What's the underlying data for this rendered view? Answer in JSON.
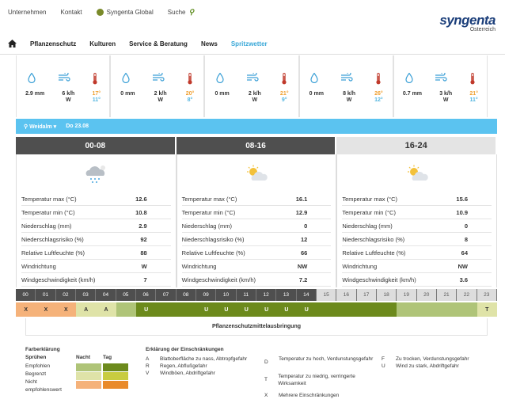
{
  "topnav": {
    "unternehmen": "Unternehmen",
    "kontakt": "Kontakt",
    "global": "Syngenta Global",
    "suche": "Suche"
  },
  "logo": {
    "brand": "syngenta",
    "country": "Österreich"
  },
  "mainnav": {
    "items": [
      "Pflanzenschutz",
      "Kulturen",
      "Service & Beratung",
      "News",
      "Spritzwetter"
    ],
    "active": "Spritzwetter"
  },
  "days": [
    {
      "stars": "",
      "precip": "2.9 mm",
      "wind": "6 k/h",
      "dir": "W",
      "tmax": "17°",
      "tmin": "11°"
    },
    {
      "stars": "",
      "precip": "0 mm",
      "wind": "2 k/h",
      "dir": "W",
      "tmax": "20°",
      "tmin": "8°"
    },
    {
      "stars": "",
      "precip": "0 mm",
      "wind": "2 k/h",
      "dir": "W",
      "tmax": "21°",
      "tmin": "9°"
    },
    {
      "stars": "",
      "precip": "0 mm",
      "wind": "8 k/h",
      "dir": "W",
      "tmax": "26°",
      "tmin": "12°"
    },
    {
      "stars": "",
      "precip": "0.7 mm",
      "wind": "3 k/h",
      "dir": "W",
      "tmax": "21°",
      "tmin": "11°"
    }
  ],
  "location": {
    "place": "Weidalm",
    "date": "Do 23.08"
  },
  "periods": [
    "00-08",
    "08-16",
    "16-24"
  ],
  "panels": [
    {
      "rows": [
        [
          "Temperatur max (°C)",
          "12.6"
        ],
        [
          "Temperatur min (°C)",
          "10.8"
        ],
        [
          "Niederschlag (mm)",
          "2.9"
        ],
        [
          "Niederschlagsrisiko (%)",
          "92"
        ],
        [
          "Relative Luftfeuchte (%)",
          "88"
        ],
        [
          "Windrichtung",
          "W"
        ],
        [
          "Windgeschwindigkeit (km/h)",
          "7"
        ]
      ]
    },
    {
      "rows": [
        [
          "Temperatur max (°C)",
          "16.1"
        ],
        [
          "Temperatur min (°C)",
          "12.9"
        ],
        [
          "Niederschlag (mm)",
          "0"
        ],
        [
          "Niederschlagsrisiko (%)",
          "12"
        ],
        [
          "Relative Luftfeuchte (%)",
          "66"
        ],
        [
          "Windrichtung",
          "NW"
        ],
        [
          "Windgeschwindigkeit (km/h)",
          "7.2"
        ]
      ]
    },
    {
      "rows": [
        [
          "Temperatur max (°C)",
          "15.6"
        ],
        [
          "Temperatur min (°C)",
          "10.9"
        ],
        [
          "Niederschlag (mm)",
          "0"
        ],
        [
          "Niederschlagsrisiko (%)",
          "8"
        ],
        [
          "Relative Luftfeuchte (%)",
          "64"
        ],
        [
          "Windrichtung",
          "NW"
        ],
        [
          "Windgeschwindigkeit (km/h)",
          "3.6"
        ]
      ]
    }
  ],
  "hours": [
    "00",
    "01",
    "02",
    "03",
    "04",
    "05",
    "06",
    "07",
    "08",
    "09",
    "10",
    "11",
    "12",
    "13",
    "14",
    "15",
    "16",
    "17",
    "18",
    "19",
    "20",
    "21",
    "22",
    "23"
  ],
  "status": [
    {
      "t": "X",
      "c": "c-or"
    },
    {
      "t": "X",
      "c": "c-or"
    },
    {
      "t": "X",
      "c": "c-or"
    },
    {
      "t": "A",
      "c": "c-ly"
    },
    {
      "t": "A",
      "c": "c-ly"
    },
    {
      "t": "",
      "c": "c-bg"
    },
    {
      "t": "U",
      "c": "c-dg"
    },
    {
      "t": "",
      "c": "c-dg"
    },
    {
      "t": "",
      "c": "c-dg"
    },
    {
      "t": "U",
      "c": "c-dg"
    },
    {
      "t": "U",
      "c": "c-dg"
    },
    {
      "t": "U",
      "c": "c-dg"
    },
    {
      "t": "U",
      "c": "c-dg"
    },
    {
      "t": "U",
      "c": "c-dg"
    },
    {
      "t": "U",
      "c": "c-dg"
    },
    {
      "t": "",
      "c": "c-dg"
    },
    {
      "t": "",
      "c": "c-dg"
    },
    {
      "t": "",
      "c": "c-dg"
    },
    {
      "t": "",
      "c": "c-dg"
    },
    {
      "t": "",
      "c": "c-bg"
    },
    {
      "t": "",
      "c": "c-bg"
    },
    {
      "t": "",
      "c": "c-bg"
    },
    {
      "t": "",
      "c": "c-bg"
    },
    {
      "t": "T",
      "c": "c-ly"
    }
  ],
  "caption": "Pflanzenschutzmittelausbringung",
  "legend": {
    "farb_title": "Farberklärung",
    "spruehen": "Sprühen",
    "nacht": "Nacht",
    "tag": "Tag",
    "empfohlen": "Empfohlen",
    "begrenzt": "Begrenzt",
    "nicht": "Nicht",
    "nicht2": "empfohlenswert",
    "erkl_title": "Erklärung der Einschränkungen",
    "items": [
      {
        "k": "A",
        "t": "Blattoberfläche zu nass, Abtropfgefahr"
      },
      {
        "k": "R",
        "t": "Regen, Abflußgefahr"
      },
      {
        "k": "V",
        "t": "Windböen, Abdriftgefahr"
      },
      {
        "k": "D",
        "t": "Temperatur zu hoch, Verdunstungsgefahr"
      },
      {
        "k": "T",
        "t": "Temperatur zu niedrig, verringerte Wirksamkeit"
      },
      {
        "k": "X",
        "t": "Mehrere Einschränkungen"
      },
      {
        "k": "F",
        "t": "Zu trocken, Verdunstungsgefahr"
      },
      {
        "k": "U",
        "t": "Wind zu stark, Abdriftgefahr"
      }
    ]
  },
  "colors": {
    "accent": "#5bc3f0",
    "header_dark": "#4f4f4f",
    "green_dark": "#6c8a1c",
    "orange": "#f5b27a"
  }
}
